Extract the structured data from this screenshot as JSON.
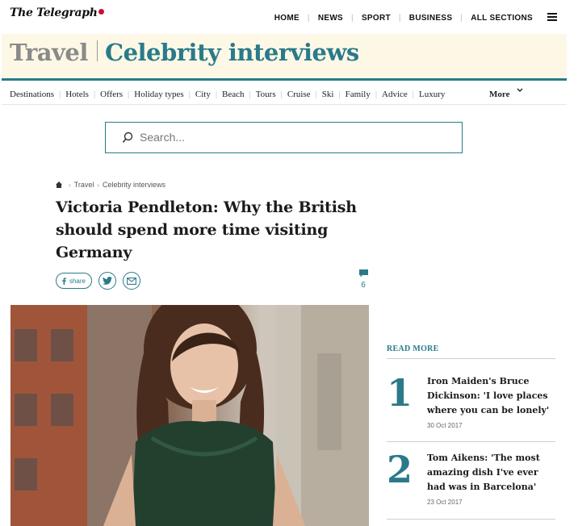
{
  "brand": {
    "logo_text": "The Telegraph"
  },
  "top_nav": [
    "HOME",
    "NEWS",
    "SPORT",
    "BUSINESS",
    "ALL SECTIONS"
  ],
  "section": {
    "title": "Travel",
    "subtitle": "Celebrity interviews"
  },
  "sub_nav": [
    "Destinations",
    "Hotels",
    "Offers",
    "Holiday types",
    "City",
    "Beach",
    "Tours",
    "Cruise",
    "Ski",
    "Family",
    "Advice",
    "Luxury"
  ],
  "more_label": "More",
  "search": {
    "placeholder": "Search..."
  },
  "breadcrumb": [
    "Travel",
    "Celebrity interviews"
  ],
  "article": {
    "headline": "Victoria Pendleton: Why the British should spend more time visiting Germany",
    "share_label": "share",
    "comment_count": "6"
  },
  "read_more": {
    "heading": "READ MORE",
    "items": [
      {
        "rank": "1",
        "title": "Iron Maiden's Bruce Dickinson: 'I love places where you can be lonely'",
        "date": "30 Oct 2017"
      },
      {
        "rank": "2",
        "title": "Tom Aikens: 'The most amazing dish I've ever had was in Barcelona'",
        "date": "23 Oct 2017"
      }
    ]
  },
  "colors": {
    "accent": "#2a7a8a",
    "banner_bg": "#fdf8e6",
    "logo_red": "#c8102e"
  },
  "icons": [
    "home-icon",
    "search-icon",
    "chevron-down-icon",
    "menu-icon",
    "facebook-icon",
    "twitter-icon",
    "email-icon",
    "comment-icon"
  ]
}
